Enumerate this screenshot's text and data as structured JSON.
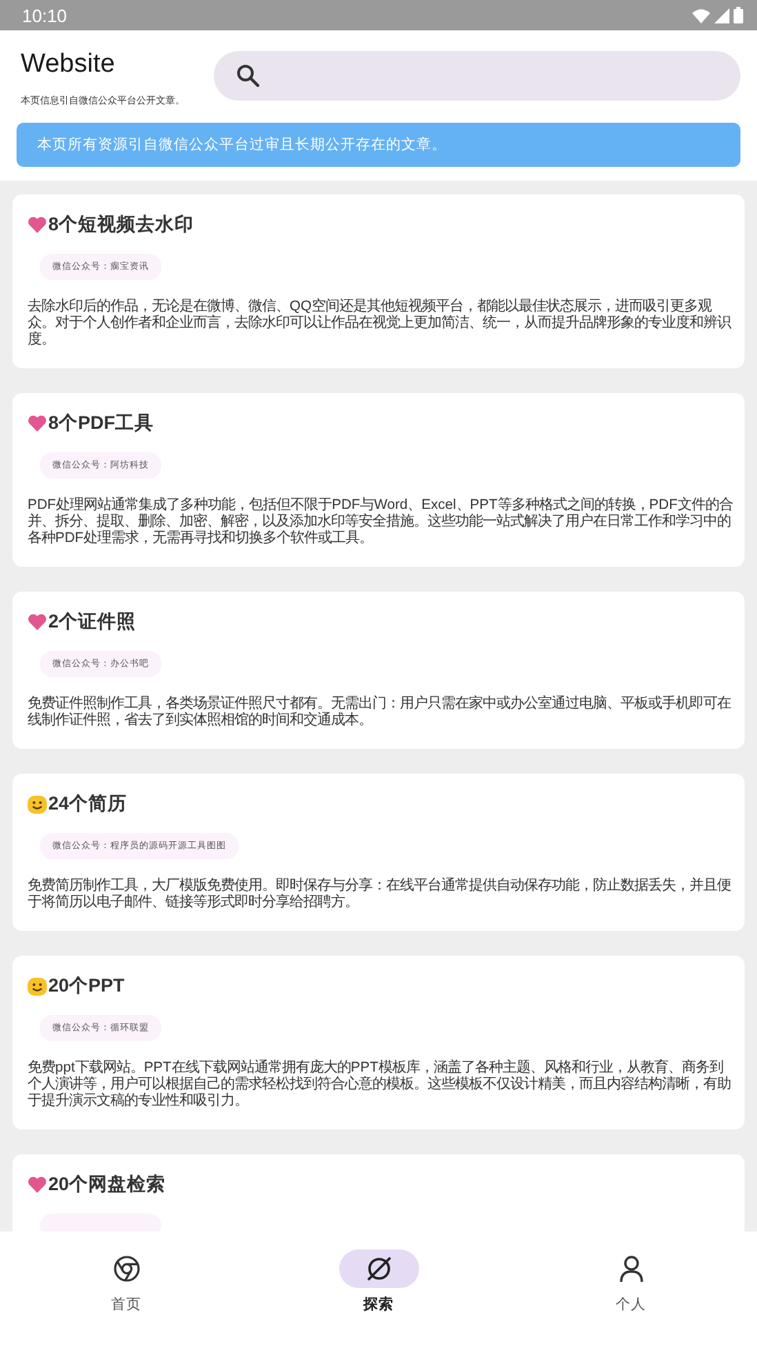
{
  "status_bar": {
    "time": "10:10"
  },
  "header": {
    "title": "Website",
    "subtitle": "本页信息引自微信公众平台公开文章。"
  },
  "notice": "本页所有资源引自微信公众平台过审且长期公开存在的文章。",
  "cards": [
    {
      "kind": "heart",
      "title": "8个短视频去水印",
      "source": "微信公众号：瘸宝资讯",
      "description": "去除水印后的作品，无论是在微博、微信、QQ空间还是其他短视频平台，都能以最佳状态展示，进而吸引更多观众。对于个人创作者和企业而言，去除水印可以让作品在视觉上更加简洁、统一，从而提升品牌形象的专业度和辨识度。"
    },
    {
      "kind": "heart",
      "title": "8个PDF工具",
      "source": "微信公众号：阿坊科技",
      "description": "PDF处理网站通常集成了多种功能，包括但不限于PDF与Word、Excel、PPT等多种格式之间的转换，PDF文件的合并、拆分、提取、删除、加密、解密，以及添加水印等安全措施。这些功能一站式解决了用户在日常工作和学习中的各种PDF处理需求，无需再寻找和切换多个软件或工具。"
    },
    {
      "kind": "heart",
      "title": "2个证件照",
      "source": "微信公众号：办公书吧",
      "description": "免费证件照制作工具，各类场景证件照尺寸都有。无需出门：用户只需在家中或办公室通过电脑、平板或手机即可在线制作证件照，省去了到实体照相馆的时间和交通成本。"
    },
    {
      "kind": "smile",
      "title": "24个简历",
      "source": "微信公众号：程序员的源码开源工具图图",
      "description": "免费简历制作工具，大厂模版免费使用。即时保存与分享：在线平台通常提供自动保存功能，防止数据丢失，并且便于将简历以电子邮件、链接等形式即时分享给招聘方。"
    },
    {
      "kind": "smile",
      "title": "20个PPT",
      "source": "微信公众号：循环联盟",
      "description": "免费ppt下载网站。PPT在线下载网站通常拥有庞大的PPT模板库，涵盖了各种主题、风格和行业，从教育、商务到个人演讲等，用户可以根据自己的需求轻松找到符合心意的模板。这些模板不仅设计精美，而且内容结构清晰，有助于提升演示文稿的专业性和吸引力。"
    },
    {
      "kind": "heart",
      "title": "20个网盘检索"
    }
  ],
  "nav": [
    {
      "label": "首页",
      "selected": false
    },
    {
      "label": "探索",
      "selected": true
    },
    {
      "label": "个人",
      "selected": false
    }
  ]
}
